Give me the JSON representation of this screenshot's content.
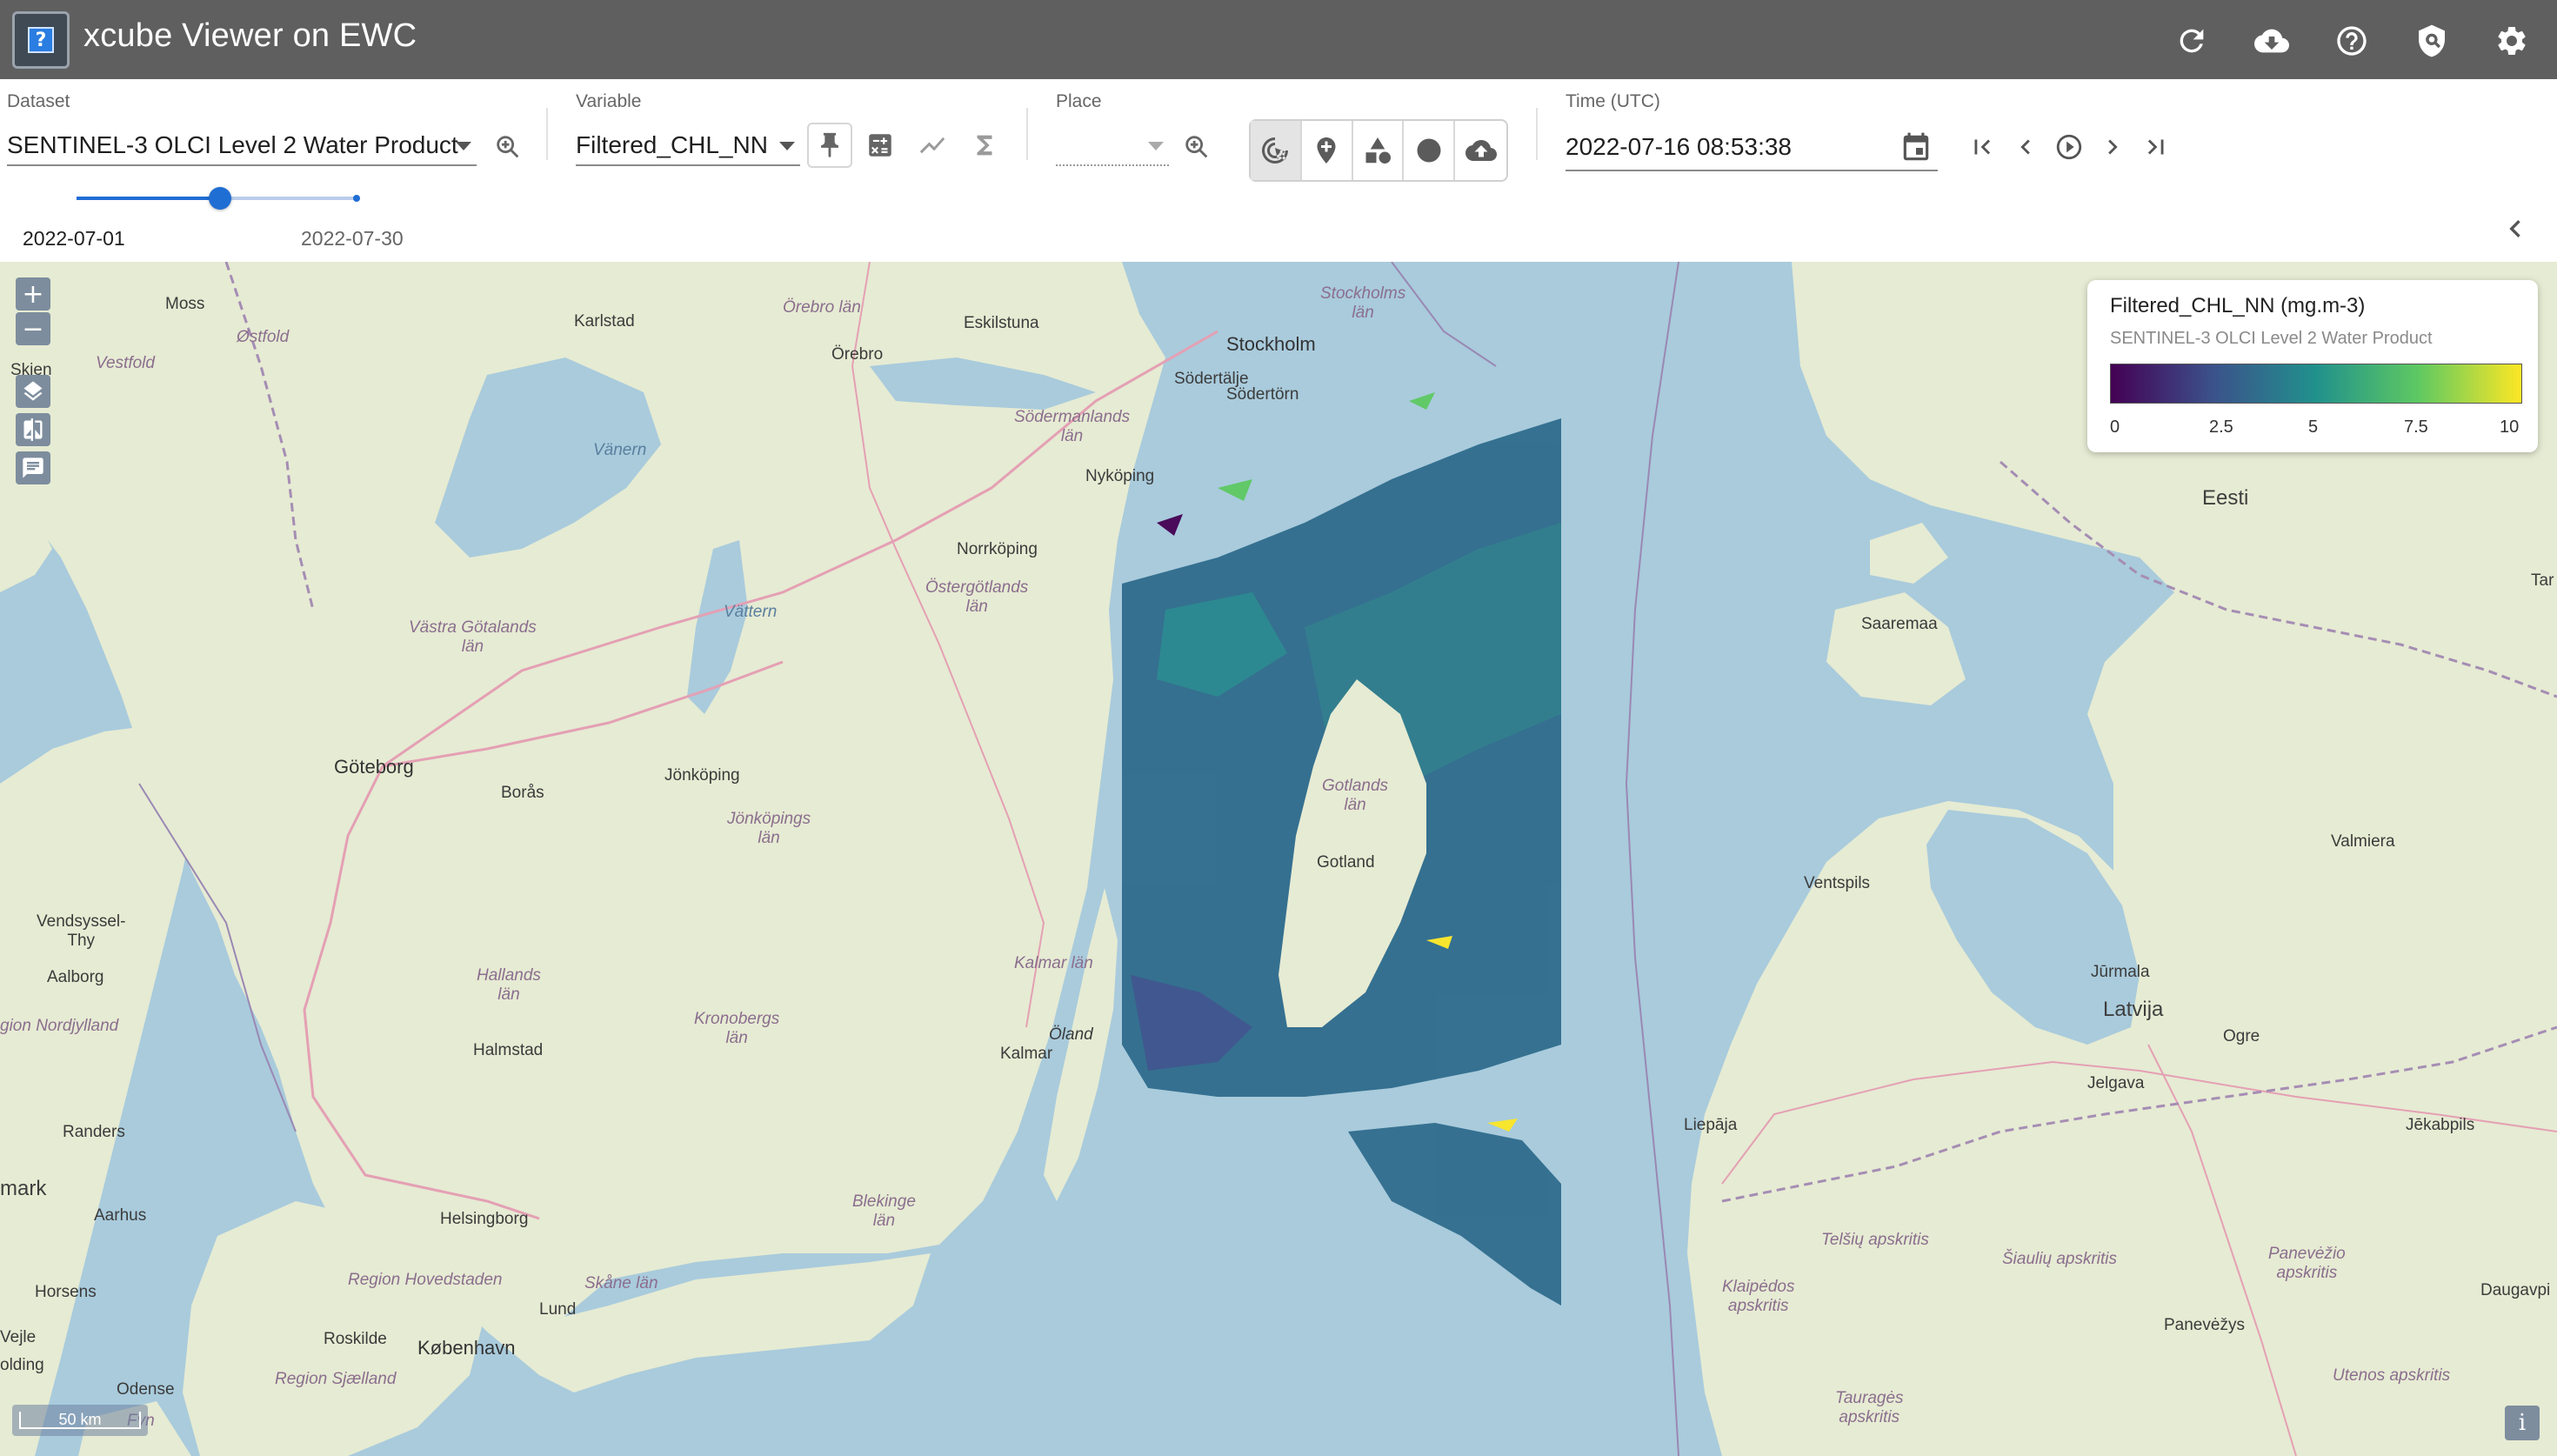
{
  "app": {
    "title": "xcube Viewer on EWC",
    "logo_glyph": "?"
  },
  "appbar_icons": [
    "refresh-icon",
    "cloud-download-icon",
    "help-icon",
    "shield-icon",
    "settings-icon"
  ],
  "dataset": {
    "label": "Dataset",
    "value": "SENTINEL-3 OLCI Level 2 Water Product"
  },
  "variable": {
    "label": "Variable",
    "value": "Filtered_CHL_NN"
  },
  "place": {
    "label": "Place",
    "value": ""
  },
  "time": {
    "label": "Time (UTC)",
    "value": "2022-07-16 08:53:38",
    "slider_start": "2022-07-01",
    "slider_end": "2022-07-30",
    "slider_position": 0.5
  },
  "map": {
    "labels": {
      "moss": "Moss",
      "ostfold": "Østfold",
      "vestfold": "Vestfold",
      "skien": "Skien",
      "karlstad": "Karlstad",
      "orebro_lan": "Örebro län",
      "orebro": "Örebro",
      "eskilstuna": "Eskilstuna",
      "stockholms_lan": "Stockholms\nlän",
      "stockholm": "Stockholm",
      "sodertalje": "Södertälje",
      "sodertorn": "Södertörn",
      "sodermanlands_lan": "Södermanlands\nlän",
      "vanern": "Vänern",
      "nykoping": "Nyköping",
      "norrkoping": "Norrköping",
      "ostergotlands_lan": "Östergötlands\nlän",
      "vattern": "Vättern",
      "vastra_gotalands_lan": "Västra Götalands\nlän",
      "goteborg": "Göteborg",
      "boras": "Borås",
      "jonkoping": "Jönköping",
      "jonkopings_lan": "Jönköpings\nlän",
      "gotlands_lan": "Gotlands\nlän",
      "gotland": "Gotland",
      "vendsyssel_thy": "Vendsyssel-\nThy",
      "aalborg": "Aalborg",
      "hallands_lan": "Hallands\nlän",
      "kronobergs_lan": "Kronobergs\nlän",
      "kalmar_lan": "Kalmar län",
      "region_nordjylland": "gion Nordjylland",
      "halmstad": "Halmstad",
      "oland": "Öland",
      "kalmar": "Kalmar",
      "randers": "Randers",
      "mark": "mark",
      "aarhus": "Aarhus",
      "helsingborg": "Helsingborg",
      "blekinge_lan": "Blekinge\nlän",
      "horsens": "Horsens",
      "region_hovedstaden": "Region Hovedstaden",
      "skane_lan": "Skåne län",
      "lund": "Lund",
      "vejle": "Vejle",
      "olding": "olding",
      "roskilde": "Roskilde",
      "kobenhavn": "København",
      "odense": "Odense",
      "region_sjaelland": "Region Sjælland",
      "fyn": "Fyn",
      "eesti": "Eesti",
      "saaremaa": "Saaremaa",
      "ventspils": "Ventspils",
      "valmiera": "Valmiera",
      "jurmala": "Jūrmala",
      "latvija": "Latvija",
      "ogre": "Ogre",
      "jelgava": "Jelgava",
      "liepaja": "Liepāja",
      "jekabpils": "Jēkabpils",
      "telsiu_apskritis": "Telšių apskritis",
      "siauliu_apskritis": "Šiaulių apskritis",
      "panevezio_apskritis": "Panevėžio\napskritis",
      "klaipedos_apskritis": "Klaipėdos\napskritis",
      "daugavpi": "Daugavpi",
      "panevezys": "Panevėžys",
      "taurages_apskritis": "Tauragės\napskritis",
      "utenos_apskritis": "Utenos apskritis",
      "tar": "Tar"
    },
    "scale_label": "50 km",
    "zoom_in": "+",
    "zoom_out": "−",
    "info": "i"
  },
  "legend": {
    "title": "Filtered_CHL_NN (mg.m-3)",
    "subtitle": "SENTINEL-3 OLCI Level 2 Water Product",
    "colormap": "viridis",
    "min": 0,
    "max": 10,
    "ticks": [
      "0",
      "2.5",
      "5",
      "7.5",
      "10"
    ]
  },
  "colors": {
    "appbar": "#5f5f5f",
    "accent": "#1f6ed4",
    "water": "#a9cbdc",
    "land": "#e7ead4"
  }
}
